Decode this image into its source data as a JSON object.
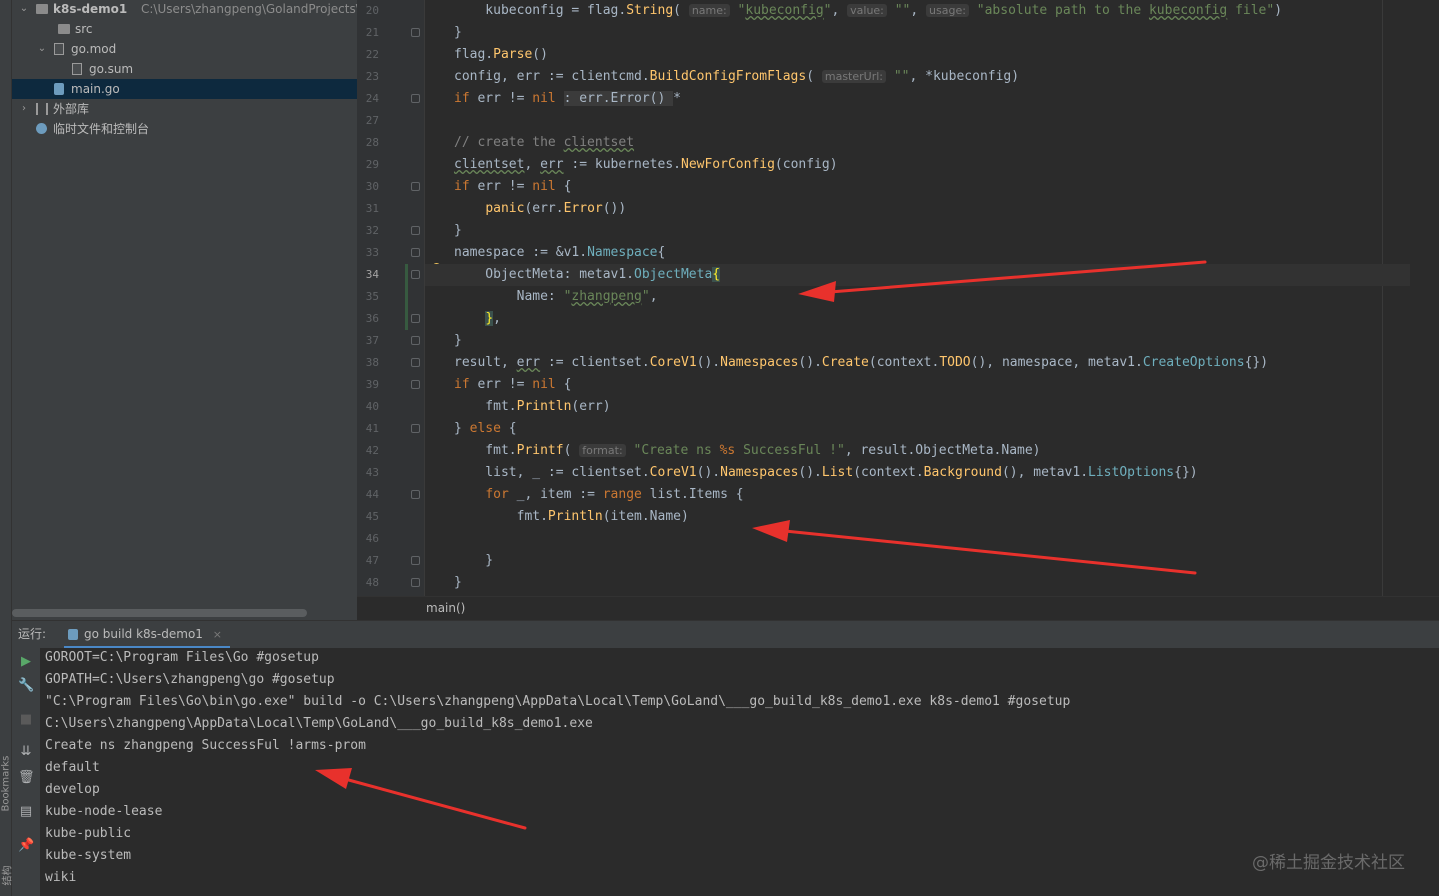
{
  "project": {
    "rows": [
      {
        "arrow": "⌄",
        "icon": "folder",
        "label": "k8s-demo1",
        "path": "C:\\Users\\zhangpeng\\GolandProjects\\k8"
      },
      {
        "arrow": "",
        "icon": "folder",
        "label": "src",
        "path": ""
      },
      {
        "arrow": "⌄",
        "icon": "file",
        "label": "go.mod",
        "path": ""
      },
      {
        "arrow": "",
        "icon": "file",
        "label": "go.sum",
        "path": ""
      },
      {
        "arrow": "",
        "icon": "gofile",
        "label": "main.go",
        "path": ""
      },
      {
        "arrow": "›",
        "icon": "lib",
        "label": "外部库",
        "path": ""
      },
      {
        "arrow": "",
        "icon": "scratch",
        "label": "临时文件和控制台",
        "path": ""
      }
    ]
  },
  "side_strip": {
    "bookmarks": "Bookmarks",
    "structure": "结构"
  },
  "editor": {
    "line_numbers": [
      "20",
      "21",
      "22",
      "23",
      "24",
      "27",
      "28",
      "29",
      "30",
      "31",
      "32",
      "33",
      "34",
      "35",
      "36",
      "37",
      "38",
      "39",
      "40",
      "41",
      "42",
      "43",
      "44",
      "45",
      "46",
      "47",
      "48"
    ],
    "current_line": "34",
    "breadcrumb": "main()",
    "code": [
      [
        [
          "    kubeconfig = flag.",
          "d"
        ],
        [
          "String",
          "fn"
        ],
        [
          "( ",
          "d"
        ],
        [
          "name:",
          "hint"
        ],
        [
          " ",
          "d"
        ],
        [
          "\"",
          "str"
        ],
        [
          "kubeconfig",
          "strw"
        ],
        [
          "\"",
          "str"
        ],
        [
          ", ",
          "d"
        ],
        [
          "value:",
          "hint"
        ],
        [
          " ",
          "d"
        ],
        [
          "\"\"",
          "str"
        ],
        [
          ", ",
          "d"
        ],
        [
          "usage:",
          "hint"
        ],
        [
          " ",
          "d"
        ],
        [
          "\"absolute path to the ",
          "str"
        ],
        [
          "kubeconfig",
          "strw"
        ],
        [
          " file\"",
          "str"
        ],
        [
          ")",
          "d"
        ]
      ],
      [
        [
          "}",
          "d"
        ]
      ],
      [
        [
          "flag.",
          "d"
        ],
        [
          "Parse",
          "fn"
        ],
        [
          "()",
          "d"
        ]
      ],
      [
        [
          "config, err := clientcmd.",
          "d"
        ],
        [
          "BuildConfigFromFlags",
          "fn"
        ],
        [
          "( ",
          "d"
        ],
        [
          "masterUrl:",
          "hint"
        ],
        [
          " ",
          "d"
        ],
        [
          "\"\"",
          "str"
        ],
        [
          ", *kubeconfig)",
          "d"
        ]
      ],
      [
        [
          "if",
          "kw"
        ],
        [
          " err != ",
          "d"
        ],
        [
          "nil",
          "kw"
        ],
        [
          " ",
          "d"
        ],
        [
          ": err.Error() ",
          "fold"
        ],
        [
          "*",
          "d"
        ]
      ],
      [
        [
          "",
          "d"
        ]
      ],
      [
        [
          "// create the ",
          "cm"
        ],
        [
          "clientset",
          "cmw"
        ]
      ],
      [
        [
          "clientset",
          "dw"
        ],
        [
          ", ",
          "d"
        ],
        [
          "err",
          "dw"
        ],
        [
          " := kubernetes.",
          "d"
        ],
        [
          "NewForConfig",
          "fn"
        ],
        [
          "(config)",
          "d"
        ]
      ],
      [
        [
          "if",
          "kw"
        ],
        [
          " err != ",
          "d"
        ],
        [
          "nil",
          "kw"
        ],
        [
          " {",
          "d"
        ]
      ],
      [
        [
          "    ",
          "d"
        ],
        [
          "panic",
          "fn"
        ],
        [
          "(err.",
          "d"
        ],
        [
          "Error",
          "fn"
        ],
        [
          "())",
          "d"
        ]
      ],
      [
        [
          "}",
          "d"
        ]
      ],
      [
        [
          "namespace := &v1.",
          "d"
        ],
        [
          "Namespace",
          "ty"
        ],
        [
          "{",
          "d"
        ]
      ],
      [
        [
          "    ObjectMeta: metav1.",
          "d"
        ],
        [
          "ObjectMeta",
          "ty"
        ],
        [
          "{",
          "br"
        ]
      ],
      [
        [
          "        Name: ",
          "d"
        ],
        [
          "\"",
          "str"
        ],
        [
          "zhangpeng",
          "strw"
        ],
        [
          "\"",
          "str"
        ],
        [
          ",",
          "d"
        ]
      ],
      [
        [
          "    ",
          "d"
        ],
        [
          "}",
          "br"
        ],
        [
          ",",
          "d"
        ]
      ],
      [
        [
          "}",
          "d"
        ]
      ],
      [
        [
          "result, ",
          "d"
        ],
        [
          "err",
          "dw"
        ],
        [
          " := clientset.",
          "d"
        ],
        [
          "CoreV1",
          "fn"
        ],
        [
          "().",
          "d"
        ],
        [
          "Namespaces",
          "fn"
        ],
        [
          "().",
          "d"
        ],
        [
          "Create",
          "fn"
        ],
        [
          "(context.",
          "d"
        ],
        [
          "TODO",
          "fn"
        ],
        [
          "(), namespace, metav1.",
          "d"
        ],
        [
          "CreateOptions",
          "ty"
        ],
        [
          "{})",
          "d"
        ]
      ],
      [
        [
          "if",
          "kw"
        ],
        [
          " err != ",
          "d"
        ],
        [
          "nil",
          "kw"
        ],
        [
          " {",
          "d"
        ]
      ],
      [
        [
          "    fmt.",
          "d"
        ],
        [
          "Println",
          "fn"
        ],
        [
          "(err)",
          "d"
        ]
      ],
      [
        [
          "} ",
          "d"
        ],
        [
          "else",
          "kw"
        ],
        [
          " {",
          "d"
        ]
      ],
      [
        [
          "    fmt.",
          "d"
        ],
        [
          "Printf",
          "fn"
        ],
        [
          "( ",
          "d"
        ],
        [
          "format:",
          "hint"
        ],
        [
          " ",
          "d"
        ],
        [
          "\"Create ns ",
          "str"
        ],
        [
          "%s",
          "esc"
        ],
        [
          " SuccessFul !\"",
          "str"
        ],
        [
          ", result.ObjectMeta.Name)",
          "d"
        ]
      ],
      [
        [
          "    list, _ := clientset.",
          "d"
        ],
        [
          "CoreV1",
          "fn"
        ],
        [
          "().",
          "d"
        ],
        [
          "Namespaces",
          "fn"
        ],
        [
          "().",
          "d"
        ],
        [
          "List",
          "fn"
        ],
        [
          "(context.",
          "d"
        ],
        [
          "Background",
          "fn"
        ],
        [
          "(), metav1.",
          "d"
        ],
        [
          "ListOptions",
          "ty"
        ],
        [
          "{})",
          "d"
        ]
      ],
      [
        [
          "    ",
          "d"
        ],
        [
          "for",
          "kw"
        ],
        [
          " _, item := ",
          "d"
        ],
        [
          "range",
          "kw"
        ],
        [
          " list.Items {",
          "d"
        ]
      ],
      [
        [
          "        fmt.",
          "d"
        ],
        [
          "Println",
          "fn"
        ],
        [
          "(item.Name)",
          "d"
        ]
      ],
      [
        [
          "",
          "d"
        ]
      ],
      [
        [
          "    }",
          "d"
        ]
      ],
      [
        [
          "}",
          "d"
        ]
      ]
    ]
  },
  "run": {
    "label": "运行:",
    "tab": "go build k8s-demo1",
    "close": "×",
    "output": [
      "GOROOT=C:\\Program Files\\Go #gosetup",
      "GOPATH=C:\\Users\\zhangpeng\\go #gosetup",
      "\"C:\\Program Files\\Go\\bin\\go.exe\" build -o C:\\Users\\zhangpeng\\AppData\\Local\\Temp\\GoLand\\___go_build_k8s_demo1.exe k8s-demo1 #gosetup",
      "C:\\Users\\zhangpeng\\AppData\\Local\\Temp\\GoLand\\___go_build_k8s_demo1.exe",
      "Create ns zhangpeng SuccessFul !arms-prom",
      "default",
      "develop",
      "kube-node-lease",
      "kube-public",
      "kube-system",
      "wiki"
    ],
    "tools": [
      "▶",
      "🔧",
      "■",
      "⇊",
      "🗑",
      "▤",
      "📌"
    ]
  },
  "watermark": "@稀土掘金技术社区",
  "colors": {
    "keyword": "#cc7832",
    "function": "#ffc66d",
    "string": "#6a8759",
    "type": "#6fafbd",
    "comment": "#808080",
    "hint": "#787878",
    "escape": "#cc7832",
    "bracket_match": "#ffef28",
    "arrow": "#e8312c"
  }
}
